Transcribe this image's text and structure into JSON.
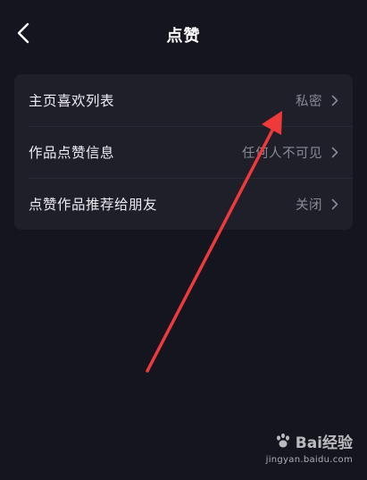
{
  "header": {
    "title": "点赞",
    "back_icon": "chevron-left-icon"
  },
  "settings": {
    "items": [
      {
        "label": "主页喜欢列表",
        "value": "私密"
      },
      {
        "label": "作品点赞信息",
        "value": "任何人不可见"
      },
      {
        "label": "点赞作品推荐给朋友",
        "value": "关闭"
      }
    ]
  },
  "annotation": {
    "color": "#f0393a",
    "points_to": "主页喜欢列表"
  },
  "watermark": {
    "logo_text": "Bai经验",
    "url": "jingyan.baidu.com"
  },
  "colors": {
    "background": "#15151f",
    "card": "#1f1f2a",
    "label": "#ecebf0",
    "value": "#8a8a95"
  }
}
